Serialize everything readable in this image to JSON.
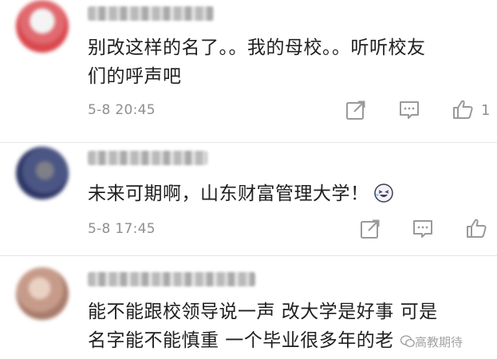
{
  "comments": [
    {
      "text_line1": "别改这样的名了。。我的母校。。听听校友",
      "text_line2": "们的呼声吧",
      "timestamp": "5-8 20:45",
      "like_count": "1"
    },
    {
      "text_line1": "未来可期啊，山东财富管理大学！",
      "timestamp": "5-8 17:45"
    },
    {
      "text_line1": "能不能跟校领导说一声 改大学是好事 可是",
      "text_line2": "名字能不能慎重 一个毕业很多年的老"
    }
  ],
  "icons": {
    "share": "share-icon",
    "comment": "comment-icon",
    "like": "thumbs-up-icon",
    "emoji": "laughing-emoji-icon"
  },
  "watermark": {
    "text": "高教期待"
  },
  "colors": {
    "text": "#202020",
    "meta": "#8f8f8f",
    "icon": "#9a9a9a",
    "divider": "#e6e6e6",
    "avatar1": "#d9494f",
    "avatar2": "#3d4a7a",
    "avatar3": "#c79b8a"
  }
}
